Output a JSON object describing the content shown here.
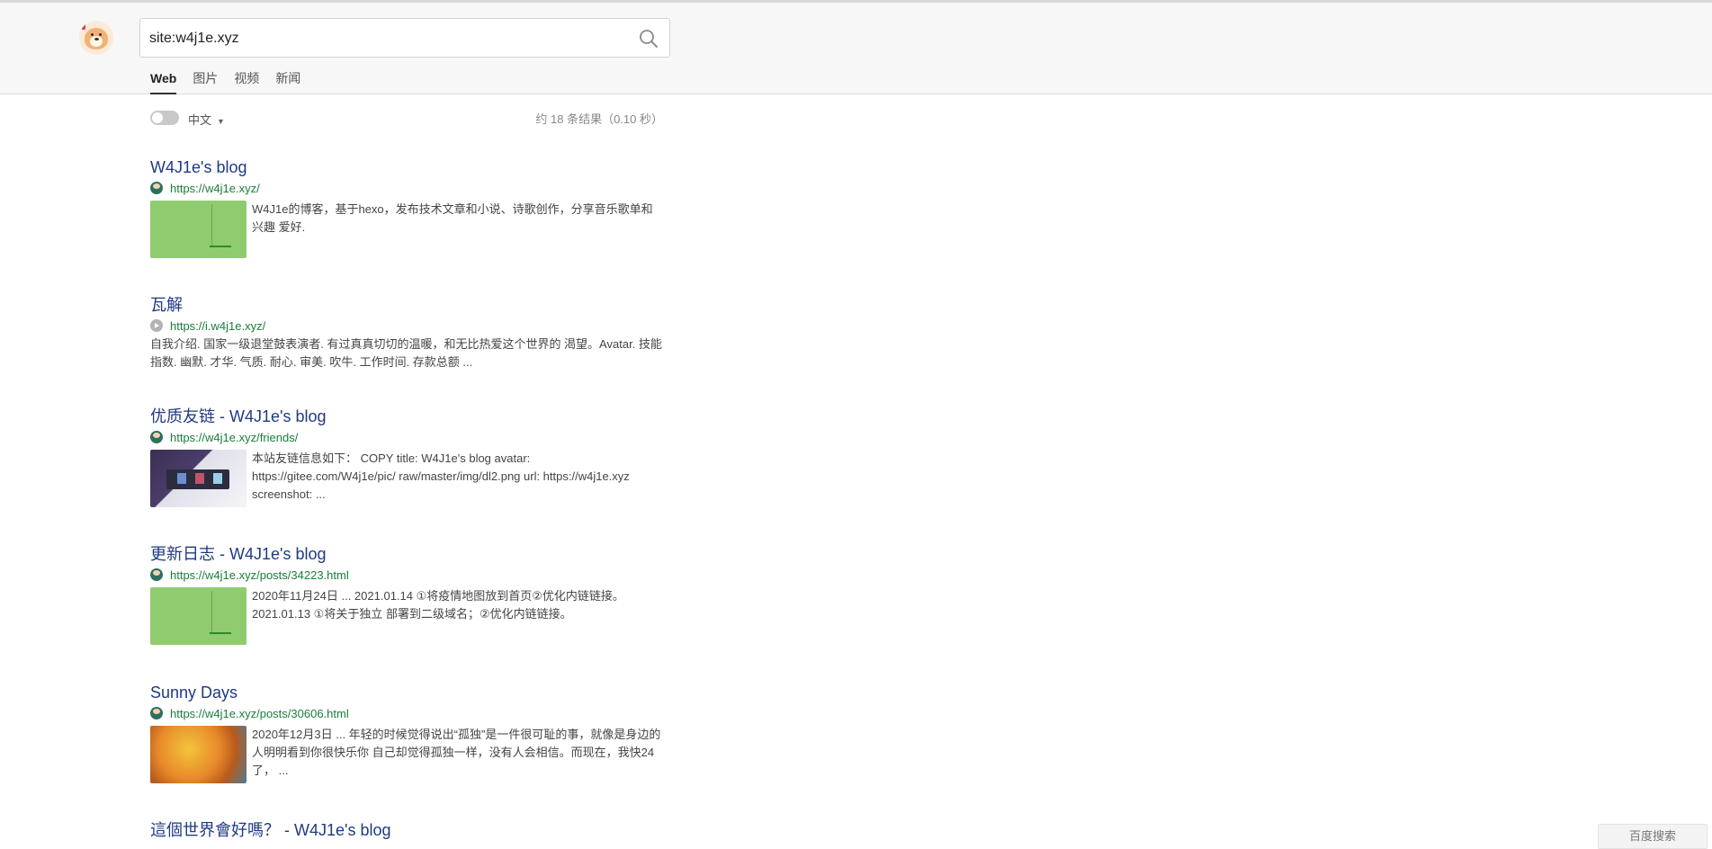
{
  "search": {
    "query": "site:w4j1e.xyz"
  },
  "tabs": [
    {
      "label": "Web",
      "active": true
    },
    {
      "label": "图片",
      "active": false
    },
    {
      "label": "视频",
      "active": false
    },
    {
      "label": "新闻",
      "active": false
    }
  ],
  "filters": {
    "language": "中文",
    "result_count": "约 18 条结果（0.10 秒）"
  },
  "results": [
    {
      "title": "W4J1e's blog",
      "url": "https://w4j1e.xyz/",
      "favicon": "blog-avatar-icon",
      "thumbnail": "green",
      "snippet": "W4J1e的博客，基于hexo，发布技术文章和小说、诗歌创作，分享音乐歌单和兴趣 爱好."
    },
    {
      "title": "瓦解",
      "url": "https://i.w4j1e.xyz/",
      "favicon": "play-circle-icon",
      "thumbnail": null,
      "snippet": "自我介绍. 国家一级退堂鼓表演者. 有过真真切切的温暖，和无比热爱这个世界的 渴望。Avatar. 技能指数. 幽默. 才华. 气质. 耐心. 审美. 吹牛. 工作时间. 存款总额 ..."
    },
    {
      "title": "优质友链 - W4J1e's blog",
      "url": "https://w4j1e.xyz/friends/",
      "favicon": "blog-avatar-icon",
      "thumbnail": "photo",
      "snippet": "本站友链信息如下： COPY title: W4J1e's blog avatar: https://gitee.com/W4j1e/pic/ raw/master/img/dl2.png url: https://w4j1e.xyz screenshot: ..."
    },
    {
      "title": "更新日志 - W4J1e's blog",
      "url": "https://w4j1e.xyz/posts/34223.html",
      "favicon": "blog-avatar-icon",
      "thumbnail": "green",
      "snippet": "2020年11月24日 ... 2021.01.14 ①将疫情地图放到首页②优化内链链接。 2021.01.13 ①将关于独立 部署到二级域名；②优化内链链接。"
    },
    {
      "title": "Sunny Days",
      "url": "https://w4j1e.xyz/posts/30606.html",
      "favicon": "blog-avatar-icon",
      "thumbnail": "sunny",
      "snippet": "2020年12月3日 ... 年轻的时候觉得说出“孤独”是一件很可耻的事，就像是身边的人明明看到你很快乐你 自己却觉得孤独一样，没有人会相信。而现在，我快24了， ..."
    },
    {
      "title": "這個世界會好嗎？ - W4J1e's blog"
    }
  ],
  "footer": {
    "corner_button": "百度搜索"
  }
}
